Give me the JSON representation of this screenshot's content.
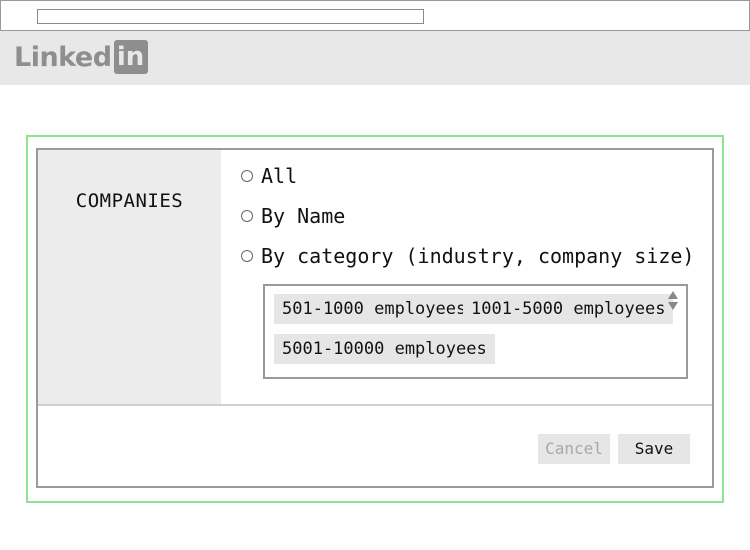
{
  "browser": {
    "url": ""
  },
  "header": {
    "logo_text": "Linked",
    "logo_box_text": "in"
  },
  "panel": {
    "section_title": "COMPANIES",
    "options": [
      {
        "label": "All",
        "selected": false
      },
      {
        "label": "By Name",
        "selected": false
      },
      {
        "label": "By category (industry, company size)",
        "selected": false
      }
    ],
    "tags": [
      "501-1000 employees",
      "1001-5000 employees",
      "5001-10000 employees"
    ],
    "buttons": {
      "cancel": "Cancel",
      "save": "Save"
    }
  },
  "colors": {
    "highlight": "#8fe58f",
    "panel_left_bg": "#ececec",
    "tag_bg": "#e6e6e6"
  }
}
